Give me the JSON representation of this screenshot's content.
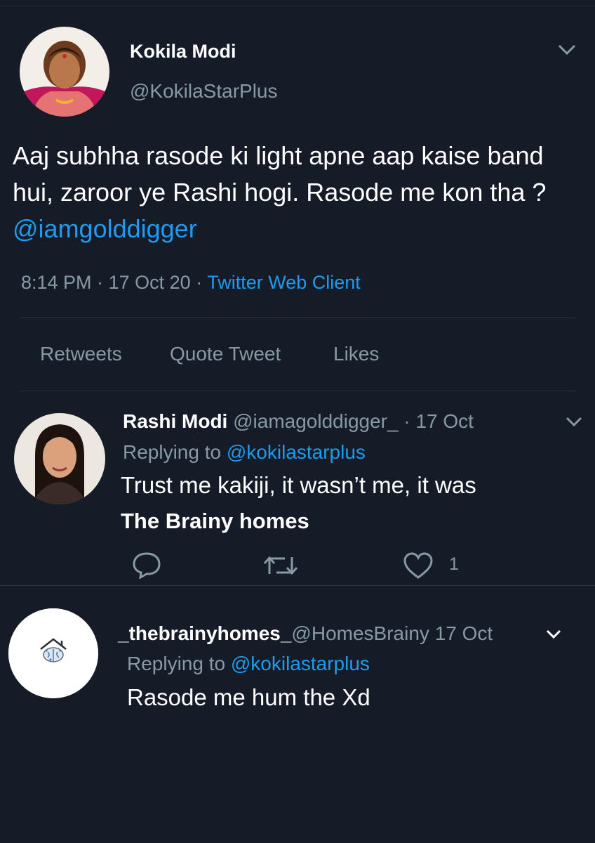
{
  "main_tweet": {
    "author_name": "Kokila Modi",
    "author_handle": "@KokilaStarPlus",
    "text": "Aaj subhha rasode  ki light apne aap kaise band hui, zaroor ye Rashi hogi. Rasode me kon tha ?",
    "mention": "@iamgolddigger",
    "time": "8:14 PM",
    "separator": "·",
    "date": "17 Oct 20",
    "client": "Twitter Web Client",
    "stats": [
      "Retweets",
      "Quote Tweet",
      "Likes"
    ]
  },
  "replies": [
    {
      "author_name": "Rashi Modi",
      "author_handle": "@iamagolddigger_",
      "date": "· 17 Oct",
      "replying_label": "Replying to",
      "replying_to": "@kokilastarplus",
      "text_line1": "Trust me kakiji, it wasn’t me, it was",
      "text_line2": "The Brainy homes",
      "like_count": "1"
    },
    {
      "author_name": "_thebrainyhomes_",
      "author_handle": "@HomesBrainy",
      "date": "17 Oct",
      "replying_label": "Replying to",
      "replying_to": "@kokilastarplus",
      "text_line1": "Rasode me hum the Xd"
    }
  ],
  "icons": [
    "chevron-down-icon",
    "reply-icon",
    "retweet-icon",
    "like-icon",
    "brain-house-logo"
  ],
  "colors": {
    "background": "#151c27",
    "accent": "#1d9bf0",
    "muted": "#8899a6"
  }
}
